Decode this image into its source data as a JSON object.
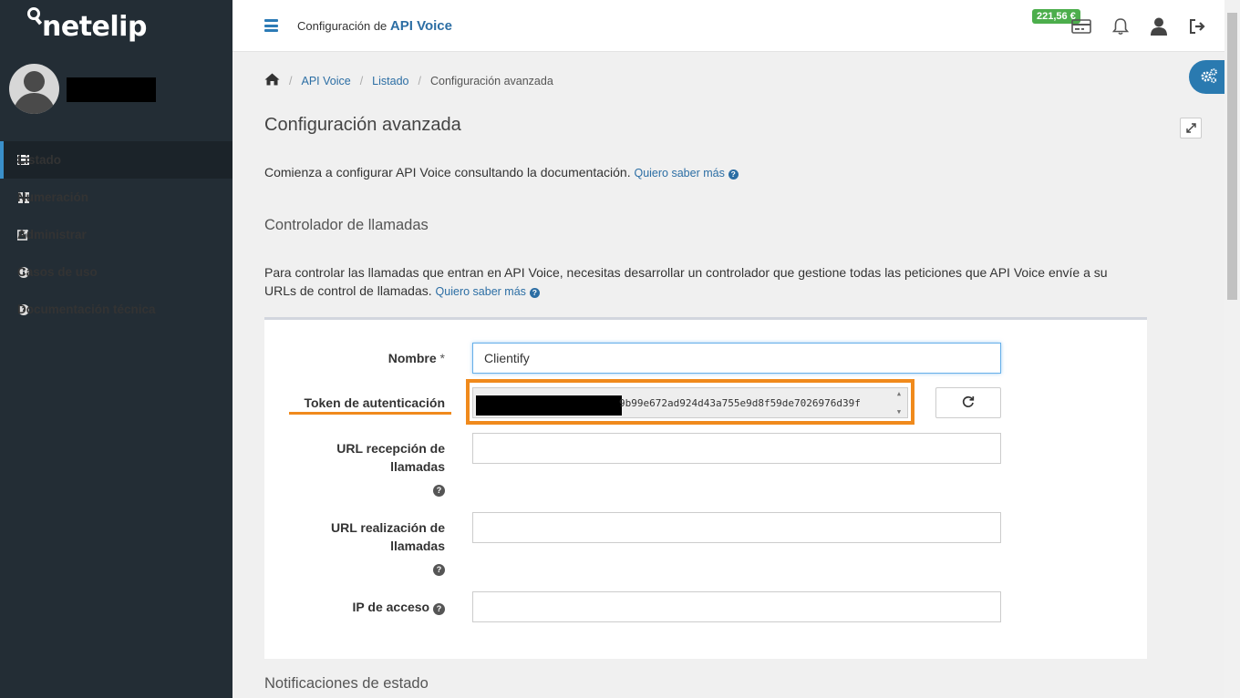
{
  "app": {
    "logo": "netelip"
  },
  "header": {
    "title_prefix": "Configuración de ",
    "title_strong": "API Voice",
    "balance": "221,56 €"
  },
  "sidebar": {
    "items": [
      {
        "label": "Listado",
        "icon": "list-icon",
        "active": true
      },
      {
        "label": "Numeración",
        "icon": "grid-icon"
      },
      {
        "label": "Administrar",
        "icon": "edit-icon"
      },
      {
        "label": "Casos de uso",
        "icon": "info-icon"
      },
      {
        "label": "Documentación técnica",
        "icon": "question-icon"
      }
    ]
  },
  "breadcrumb": {
    "items": [
      "API Voice",
      "Listado"
    ],
    "current": "Configuración avanzada"
  },
  "page": {
    "title": "Configuración avanzada",
    "intro": "Comienza a configurar API Voice consultando la documentación. ",
    "more_link": "Quiero saber más"
  },
  "controller": {
    "title": "Controlador de llamadas",
    "desc": "Para controlar las llamadas que entran en API Voice, necesitas desarrollar un controlador que gestione todas las peticiones que API Voice envíe a su URLs de control de llamadas. ",
    "more_link": "Quiero saber más"
  },
  "form": {
    "name_label": "Nombre",
    "required_mark": "*",
    "name_value": "Clientify",
    "token_label": "Token de autenticación",
    "token_value": "9b99e672ad924d43a755e9d8f59de7026976d39f",
    "url_reception_label_1": "URL recepción de",
    "url_reception_label_2": "llamadas",
    "url_reception_value": "",
    "url_origination_label_1": "URL realización de",
    "url_origination_label_2": "llamadas",
    "url_origination_value": "",
    "ip_label": "IP de acceso",
    "ip_value": ""
  },
  "notifications": {
    "title": "Notificaciones de estado"
  },
  "colors": {
    "sidebar": "#232d35",
    "accent": "#2c6ea4",
    "highlight": "#f08a1c",
    "balance": "#4cae4c"
  }
}
